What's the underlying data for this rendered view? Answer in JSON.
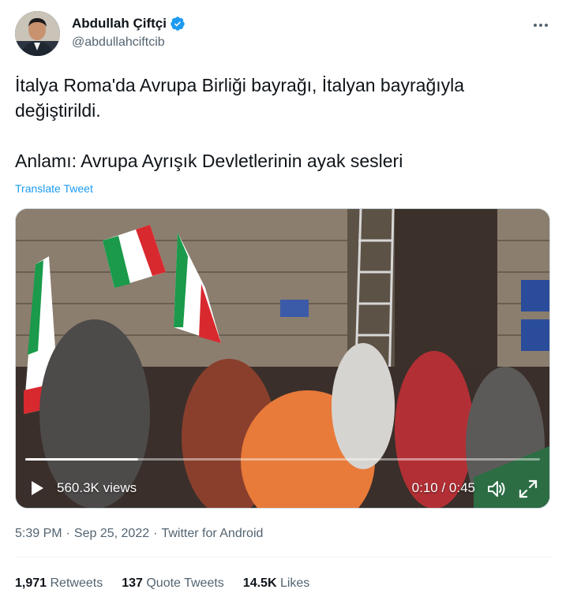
{
  "author": {
    "display_name": "Abdullah Çiftçi",
    "handle": "@abdullahciftcib",
    "verified": true,
    "avatar_icon": "profile-photo",
    "more_icon": "more-horizontal-icon"
  },
  "tweet": {
    "line1": "İtalya Roma'da Avrupa Birliği bayrağı, İtalyan bayrağıyla değiştirildi.",
    "line2": "Anlamı: Avrupa Ayrışık Devletlerinin ayak sesleri",
    "translate_label": "Translate Tweet"
  },
  "video": {
    "views": "560.3K views",
    "time": "0:10 / 0:45",
    "progress": 0.22,
    "icons": [
      "play-icon",
      "volume-icon",
      "fullscreen-icon"
    ]
  },
  "meta": {
    "time": "5:39 PM",
    "separator": "·",
    "date": "Sep 25, 2022",
    "client": "Twitter for Android"
  },
  "stats": {
    "retweets_count": "1,971",
    "retweets_label": "Retweets",
    "quotes_count": "137",
    "quotes_label": "Quote Tweets",
    "likes_count": "14.5K",
    "likes_label": "Likes"
  },
  "colors": {
    "accent": "#1d9bf0",
    "secondary_text": "#536471",
    "primary_text": "#0f1419",
    "divider": "#eff3f4"
  }
}
